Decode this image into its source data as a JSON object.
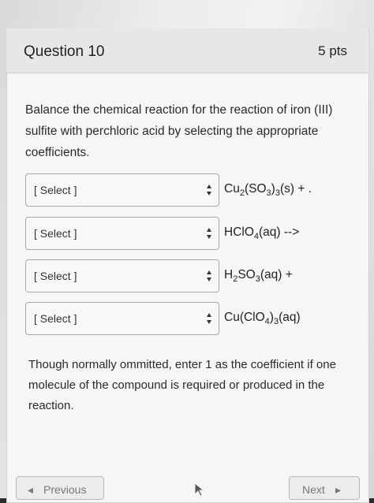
{
  "question": {
    "title": "Question 10",
    "points": "5 pts",
    "prompt": "Balance the chemical reaction for the reaction of iron (III) sulfite with perchloric acid by selecting the appropriate coefficients."
  },
  "rows": [
    {
      "select": "[ Select ]",
      "formula_parts": [
        "Cu",
        "2",
        "(SO",
        "3",
        ")",
        "3",
        "(s) + ."
      ]
    },
    {
      "select": "[ Select ]",
      "formula_parts": [
        "HClO",
        "4",
        "(aq) -->"
      ]
    },
    {
      "select": "[ Select ]",
      "formula_parts": [
        "H",
        "2",
        "SO",
        "3",
        "(aq) +"
      ]
    },
    {
      "select": "[ Select ]",
      "formula_parts": [
        "Cu(ClO",
        "4",
        ")",
        "3",
        "(aq)"
      ]
    }
  ],
  "note": "Though normally ommitted, enter 1 as the coefficient if one molecule of the compound is required or produced in the reaction.",
  "nav": {
    "previous_label": "Previous",
    "next_label": "Next"
  },
  "icons": {
    "previous": "chevron-left-icon",
    "next": "chevron-right-icon",
    "select": "select-arrows-icon",
    "cursor": "mouse-cursor-icon"
  }
}
